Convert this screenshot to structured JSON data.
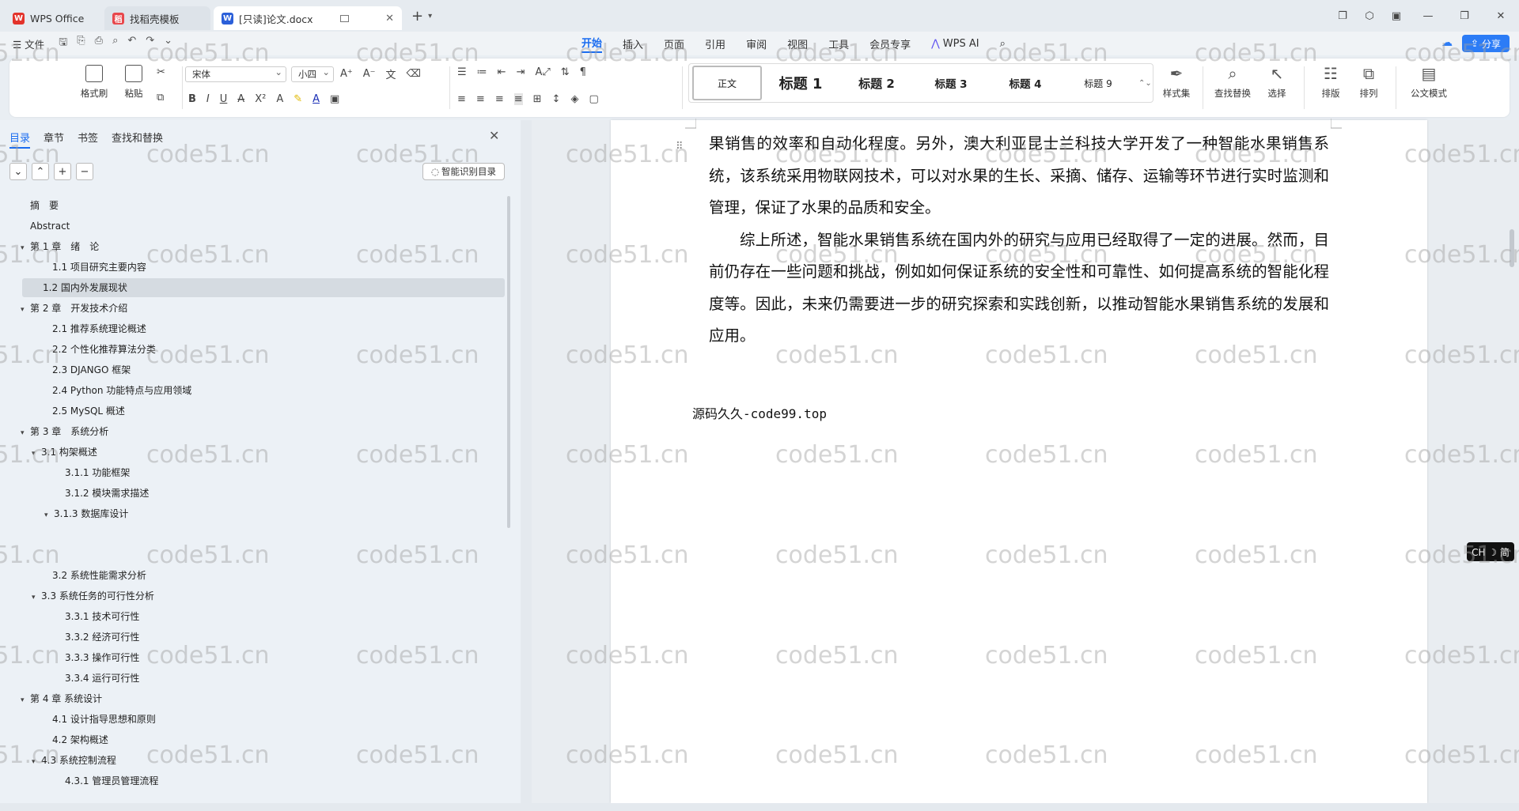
{
  "tabs": [
    {
      "label": "WPS Office",
      "icon": "wps-logo-icon"
    },
    {
      "label": "找稻壳模板",
      "icon": "docer-icon"
    },
    {
      "label": "[只读]论文.docx",
      "icon": "word-doc-icon"
    }
  ],
  "menu": {
    "file": "☰ 文件",
    "tabs": [
      "开始",
      "插入",
      "页面",
      "引用",
      "审阅",
      "视图",
      "工具",
      "会员专享"
    ],
    "active_tab": "开始",
    "wps_ai": "WPS AI",
    "share": "分享"
  },
  "ribbon": {
    "format_painter": "格式刷",
    "paste": "粘贴",
    "font_name": "宋体",
    "font_size": "小四",
    "styles": [
      "正文",
      "标题 1",
      "标题 2",
      "标题 3",
      "标题 4",
      "标题 9"
    ],
    "style_set": "样式集",
    "find_replace": "查找替换",
    "select": "选择",
    "layout": "排版",
    "arrange": "排列",
    "official_mode": "公文模式"
  },
  "left_pane": {
    "tabs": [
      "目录",
      "章节",
      "书签",
      "查找和替换"
    ],
    "active_tab": "目录",
    "smart_toc": "智能识别目录",
    "toc": [
      {
        "label": "摘　要",
        "level": 0,
        "arrow": false
      },
      {
        "label": "Abstract",
        "level": 0,
        "arrow": false
      },
      {
        "label": "第 1 章　绪　论",
        "level": 0,
        "arrow": true
      },
      {
        "label": "1.1 项目研究主要内容",
        "level": 1,
        "arrow": false
      },
      {
        "label": "1.2  国内外发展现状",
        "level": 1,
        "arrow": false,
        "selected": true
      },
      {
        "label": "第 2 章　开发技术介绍",
        "level": 0,
        "arrow": true
      },
      {
        "label": "2.1  推荐系统理论概述",
        "level": 1,
        "arrow": false
      },
      {
        "label": "2.2  个性化推荐算法分类",
        "level": 1,
        "arrow": false
      },
      {
        "label": "2.3 DJANGO 框架",
        "level": 1,
        "arrow": false
      },
      {
        "label": "2.4 Python  功能特点与应用领域",
        "level": 1,
        "arrow": false
      },
      {
        "label": "2.5 MySQL 概述",
        "level": 1,
        "arrow": false
      },
      {
        "label": "第 3 章　系统分析",
        "level": 0,
        "arrow": true
      },
      {
        "label": "3.1  构架概述",
        "level": 1,
        "arrow": true
      },
      {
        "label": "3.1.1  功能框架",
        "level": 2,
        "arrow": false
      },
      {
        "label": "3.1.2  模块需求描述",
        "level": 2,
        "arrow": false
      },
      {
        "label": "3.1.3  数据库设计",
        "level": 2,
        "arrow": true
      },
      {
        "label": "",
        "level": 0,
        "arrow": false
      },
      {
        "label": "",
        "level": 0,
        "arrow": false
      },
      {
        "label": "3.2 系统性能需求分析",
        "level": 1,
        "arrow": false
      },
      {
        "label": "3.3  系统任务的可行性分析",
        "level": 1,
        "arrow": true
      },
      {
        "label": "3.3.1 技术可行性",
        "level": 2,
        "arrow": false
      },
      {
        "label": "3.3.2 经济可行性",
        "level": 2,
        "arrow": false
      },
      {
        "label": "3.3.3 操作可行性",
        "level": 2,
        "arrow": false
      },
      {
        "label": "3.3.4  运行可行性",
        "level": 2,
        "arrow": false
      },
      {
        "label": "第 4 章  系统设计",
        "level": 0,
        "arrow": true
      },
      {
        "label": "4.1 设计指导思想和原则",
        "level": 1,
        "arrow": false
      },
      {
        "label": "4.2  架构概述",
        "level": 1,
        "arrow": false
      },
      {
        "label": "4.3  系统控制流程",
        "level": 1,
        "arrow": true
      },
      {
        "label": "4.3.1  管理员管理流程",
        "level": 2,
        "arrow": false
      }
    ]
  },
  "document": {
    "para1": "果销售的效率和自动化程度。另外，澳大利亚昆士兰科技大学开发了一种智能水果销售系统，该系统采用物联网技术，可以对水果的生长、采摘、储存、运输等环节进行实时监测和管理，保证了水果的品质和安全。",
    "para2": "综上所述，智能水果销售系统在国内外的研究与应用已经取得了一定的进展。然而，目前仍存在一些问题和挑战，例如如何保证系统的安全性和可靠性、如何提高系统的智能化程度等。因此，未来仍需要进一步的研究探索和实践创新，以推动智能水果销售系统的发展和应用。",
    "source_line": "源码久久-code99.top"
  },
  "ime": "CH ☽ 简",
  "watermark": "code51.cn",
  "colors": {
    "accent": "#1a6cf0",
    "share_bg": "#2c7cf6"
  }
}
